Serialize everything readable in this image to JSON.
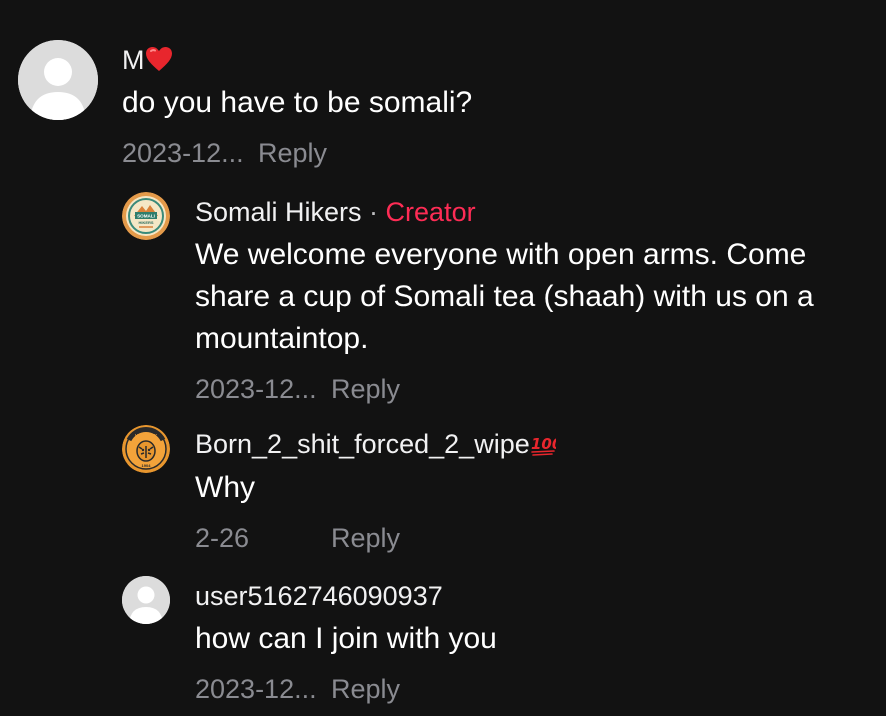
{
  "comments": [
    {
      "username": "M",
      "username_badge": "heart-emoji",
      "text": "do you have to be somali?",
      "date": "2023-12...",
      "reply_label": "Reply",
      "avatar": "default-avatar"
    },
    {
      "username": "Somali Hikers",
      "separator": " · ",
      "role": "Creator",
      "text": "We welcome everyone with open arms. Come share a cup of Somali tea (shaah) with us on a mountaintop.",
      "date": "2023-12...",
      "reply_label": "Reply",
      "avatar": "somali-hikers-logo",
      "logo_text": "SOMALI HIKERS"
    },
    {
      "username": "Born_2_shit_forced_2_wipe",
      "username_badge": "hundred-points-emoji",
      "text": "Why",
      "date": "2-26",
      "reply_label": "Reply",
      "avatar": "hull-city-crest",
      "logo_text": "HULL CITY",
      "logo_year": "1904"
    },
    {
      "username": "user5162746090937",
      "text": "how can I join with you",
      "date": "2023-12...",
      "reply_label": "Reply",
      "avatar": "default-avatar"
    }
  ],
  "colors": {
    "background": "#121212",
    "creator": "#fe2c55",
    "meta": "#8a8b91"
  }
}
